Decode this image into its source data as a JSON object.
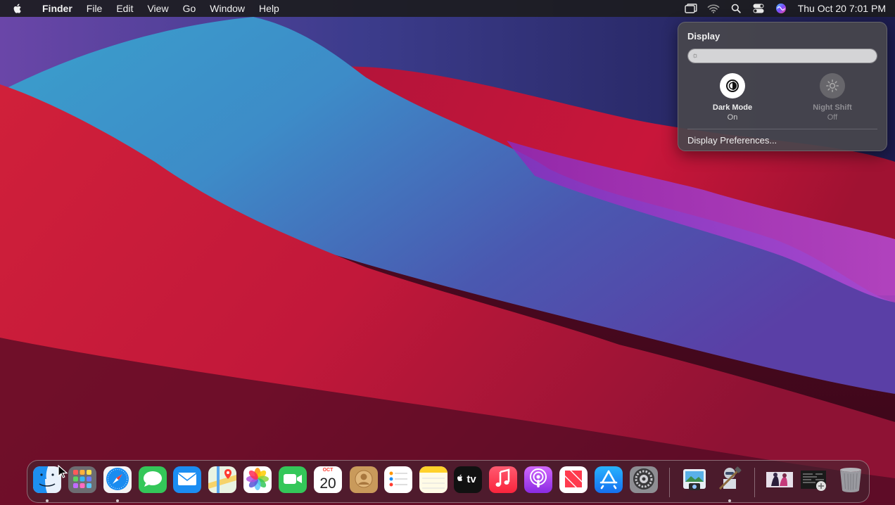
{
  "menubar": {
    "app_name": "Finder",
    "menus": [
      "File",
      "Edit",
      "View",
      "Go",
      "Window",
      "Help"
    ],
    "clock": "Thu Oct 20  7:01 PM",
    "status_icons": [
      "screen-mirroring-icon",
      "wifi-icon",
      "spotlight-search-icon",
      "control-center-icon",
      "siri-icon"
    ]
  },
  "display_panel": {
    "title": "Display",
    "brightness": 1.0,
    "dark_mode": {
      "label": "Dark Mode",
      "state": "On"
    },
    "night_shift": {
      "label": "Night Shift",
      "state": "Off"
    },
    "preferences_link": "Display Preferences..."
  },
  "dock": {
    "apps": [
      {
        "name": "Finder",
        "icon": "finder-icon",
        "running": true
      },
      {
        "name": "Launchpad",
        "icon": "launchpad-icon",
        "running": false
      },
      {
        "name": "Safari",
        "icon": "safari-icon",
        "running": true
      },
      {
        "name": "Messages",
        "icon": "messages-icon",
        "running": false
      },
      {
        "name": "Mail",
        "icon": "mail-icon",
        "running": false
      },
      {
        "name": "Maps",
        "icon": "maps-icon",
        "running": false
      },
      {
        "name": "Photos",
        "icon": "photos-icon",
        "running": false
      },
      {
        "name": "FaceTime",
        "icon": "facetime-icon",
        "running": false
      },
      {
        "name": "Calendar",
        "icon": "calendar-icon",
        "running": false,
        "month": "OCT",
        "day": "20"
      },
      {
        "name": "Contacts",
        "icon": "contacts-icon",
        "running": false
      },
      {
        "name": "Reminders",
        "icon": "reminders-icon",
        "running": false
      },
      {
        "name": "Notes",
        "icon": "notes-icon",
        "running": false
      },
      {
        "name": "TV",
        "icon": "apple-tv-icon",
        "running": false,
        "label": "tv"
      },
      {
        "name": "Music",
        "icon": "music-icon",
        "running": false
      },
      {
        "name": "Podcasts",
        "icon": "podcasts-icon",
        "running": false
      },
      {
        "name": "News",
        "icon": "news-icon",
        "running": false
      },
      {
        "name": "App Store",
        "icon": "app-store-icon",
        "running": false
      },
      {
        "name": "System Preferences",
        "icon": "system-preferences-icon",
        "running": false
      },
      {
        "name": "Preview",
        "icon": "preview-icon",
        "running": false
      },
      {
        "name": "Automator",
        "icon": "automator-icon",
        "running": true
      },
      {
        "name": "Image Thumbnail",
        "icon": "image-thumbnail-icon",
        "running": false
      },
      {
        "name": "Screenshot Thumbnail",
        "icon": "screenshot-thumbnail-icon",
        "running": false
      },
      {
        "name": "Trash",
        "icon": "trash-icon",
        "running": false
      }
    ]
  },
  "colors": {
    "menubar_bg": "#1c1c20",
    "panel_bg": "#48464c",
    "accent_blue": "#1e8bf5"
  }
}
